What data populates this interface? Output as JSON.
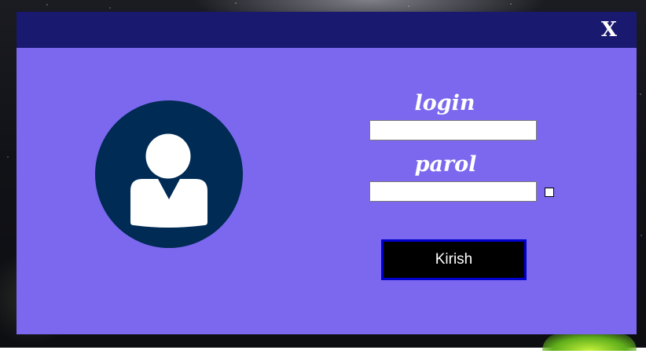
{
  "window": {
    "close_label": "X"
  },
  "form": {
    "login_label": "login",
    "login_value": "",
    "parol_label": "parol",
    "parol_value": "",
    "show_password_checked": false,
    "submit_label": "Kirish"
  },
  "icons": {
    "avatar": "user-avatar-icon"
  },
  "colors": {
    "title_bar": "#191970",
    "form_background": "#7b68ee",
    "avatar_circle": "#002b55",
    "button_background": "#000000",
    "button_border": "#0000cd"
  }
}
